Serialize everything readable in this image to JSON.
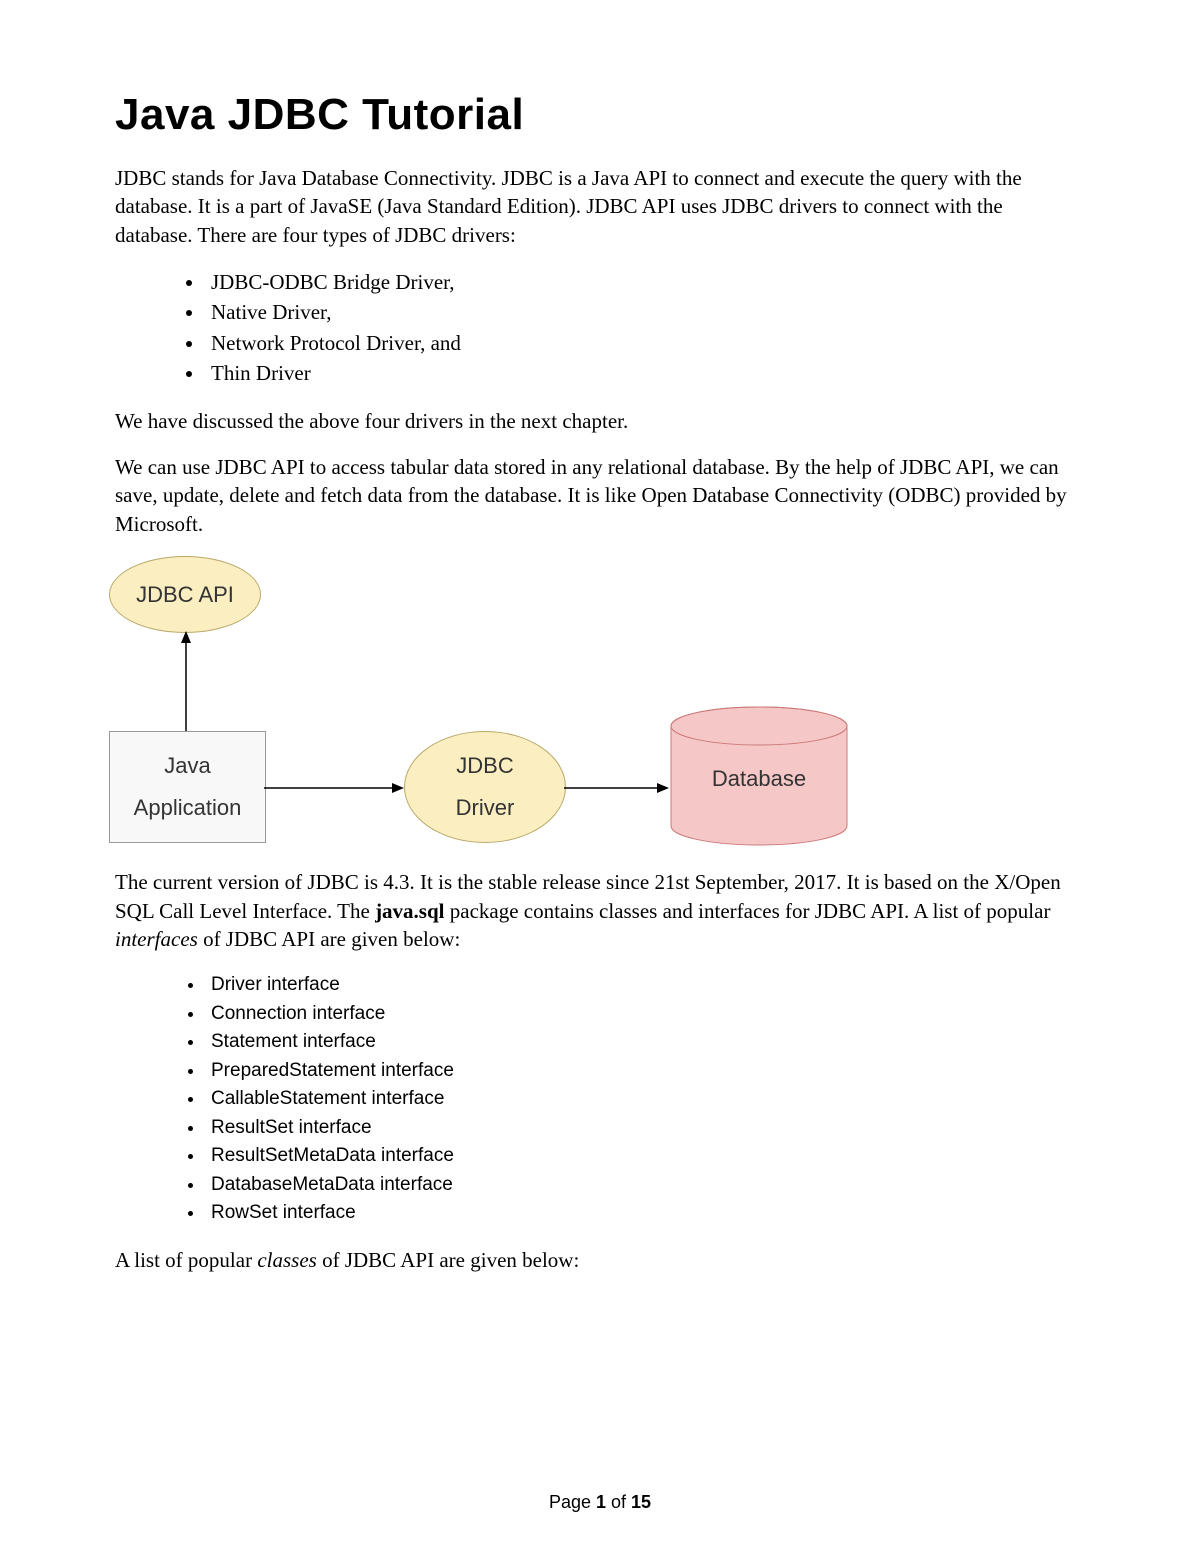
{
  "title": "Java JDBC Tutorial",
  "intro": "JDBC stands for Java Database Connectivity. JDBC is a Java API to connect and execute the query with the database. It is a part of JavaSE (Java Standard Edition). JDBC API uses JDBC drivers to connect with the database. There are four types of JDBC drivers:",
  "drivers": [
    "JDBC-ODBC Bridge Driver,",
    "Native Driver,",
    "Network Protocol Driver, and",
    "Thin Driver"
  ],
  "after_drivers_1": "We have discussed the above four drivers in the next chapter.",
  "after_drivers_2": "We can use JDBC API to access tabular data stored in any relational database. By the help of JDBC API, we can save, update, delete and fetch data from the database. It is like Open Database Connectivity (ODBC) provided by Microsoft.",
  "diagram": {
    "jdbc_api": "JDBC API",
    "java_app_l1": "Java",
    "java_app_l2": "Application",
    "jdbc_driver_l1": "JDBC",
    "jdbc_driver_l2": "Driver",
    "database": "Database"
  },
  "version_p": {
    "pre": "The current version of JDBC is 4.3. It is the stable release since 21st September, 2017. It is based on the X/Open SQL Call Level Interface. The ",
    "pkg": "java.sql",
    "mid": " package contains classes and interfaces for JDBC API. A list of popular ",
    "word_interfaces": "interfaces",
    "post": " of JDBC API are given below:"
  },
  "interfaces": [
    "Driver interface",
    "Connection interface",
    "Statement interface",
    "PreparedStatement interface",
    "CallableStatement interface",
    "ResultSet interface",
    "ResultSetMetaData interface",
    "DatabaseMetaData interface",
    "RowSet interface"
  ],
  "classes_p": {
    "pre": "A list of popular ",
    "word_classes": "classes",
    "post": " of JDBC API are given below:"
  },
  "footer": {
    "pre": "Page ",
    "current": "1",
    "mid": " of ",
    "total": "15"
  }
}
